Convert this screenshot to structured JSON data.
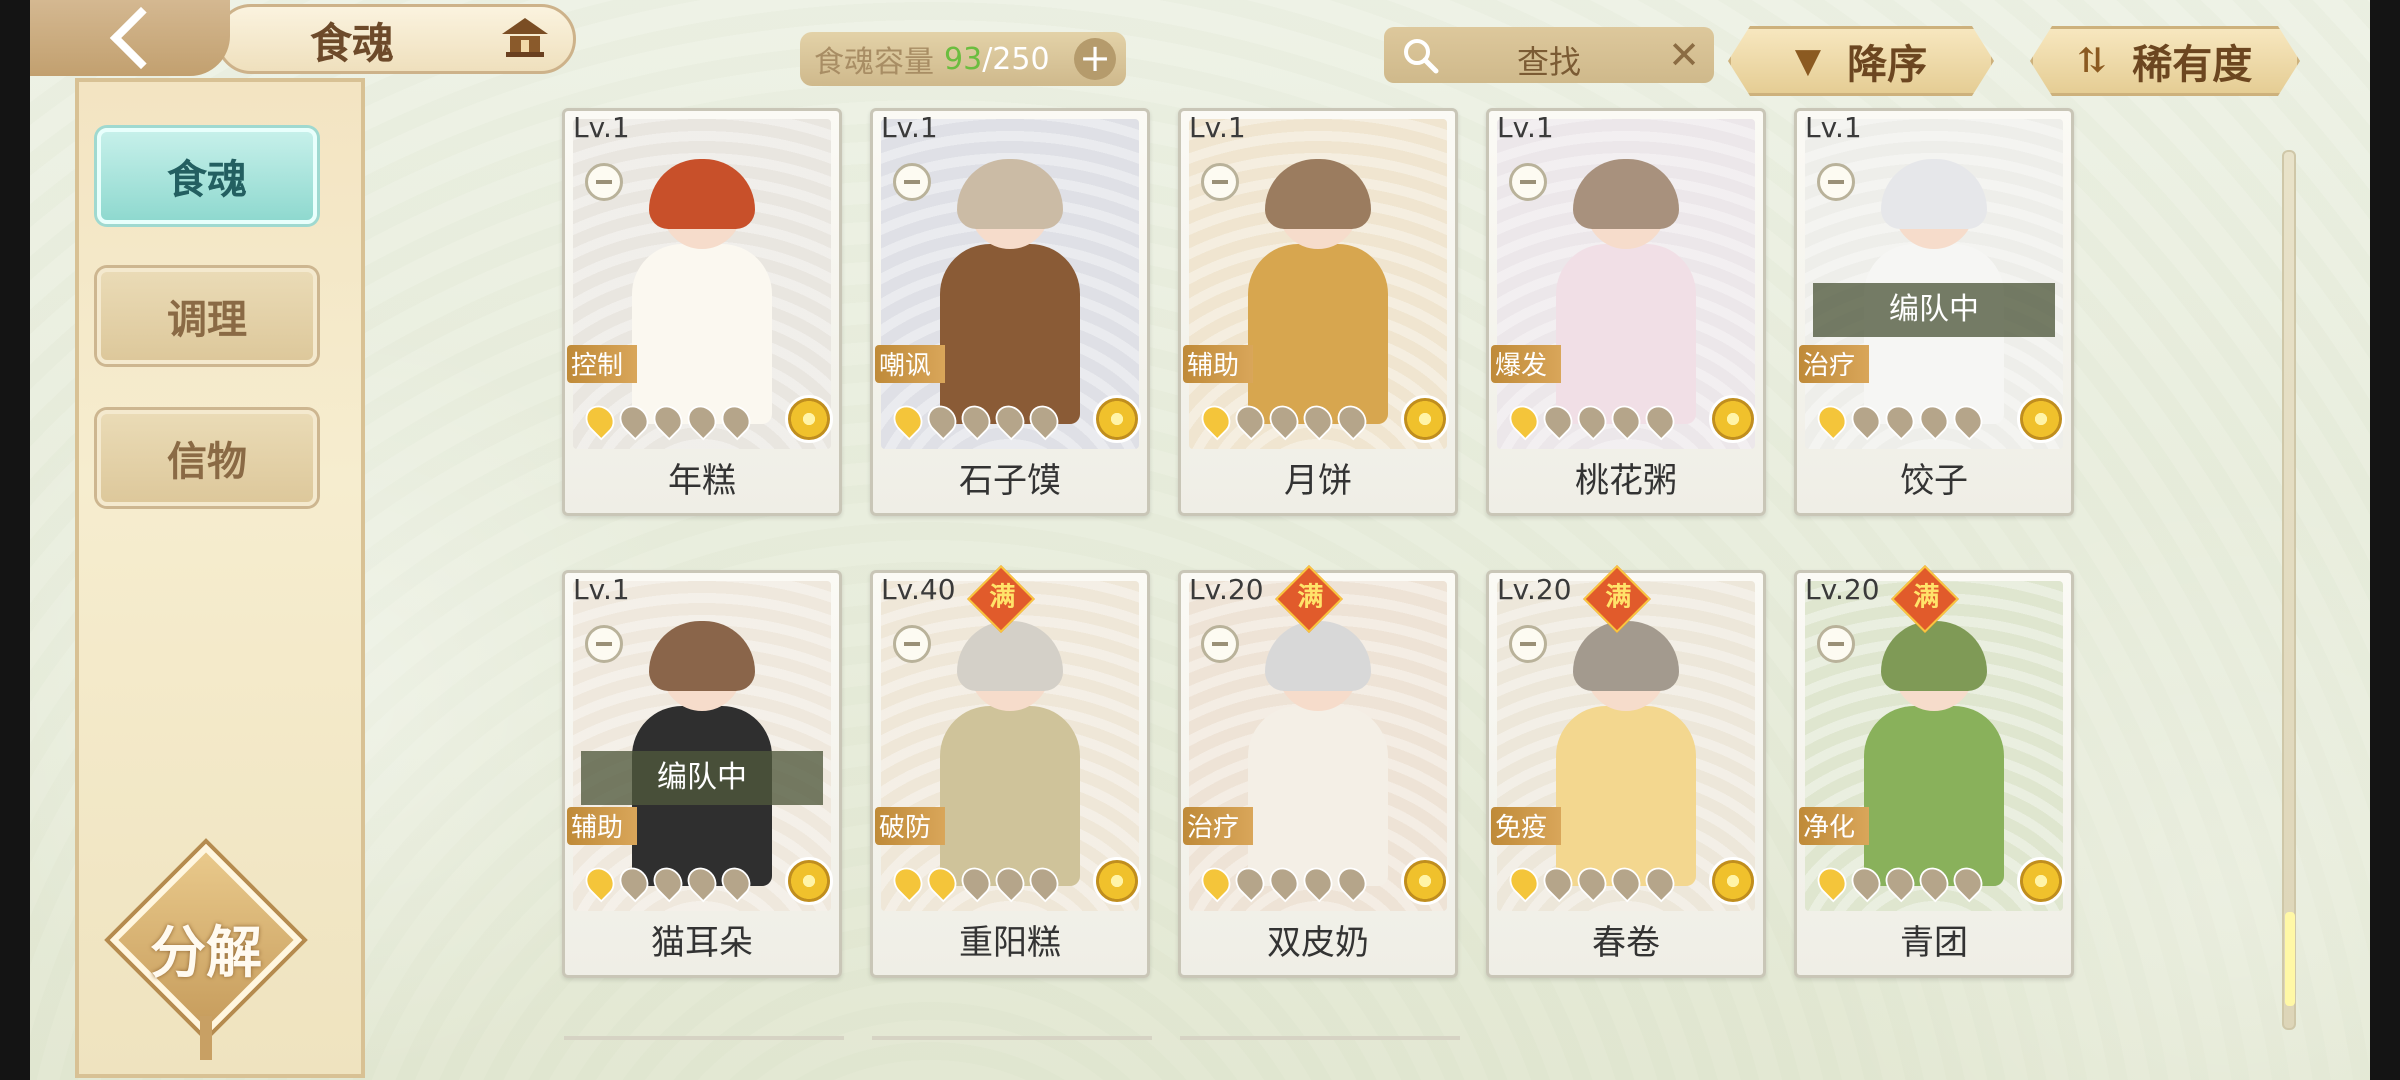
{
  "header": {
    "title": "食魂",
    "capacity_label": "食魂容量",
    "capacity_current": "93",
    "capacity_sep": "/",
    "capacity_max": "250",
    "search_placeholder": "查找",
    "sort_order_label": "降序",
    "sort_field_label": "稀有度"
  },
  "sidebar": {
    "items": [
      {
        "label": "食魂",
        "active": true
      },
      {
        "label": "调理",
        "active": false
      },
      {
        "label": "信物",
        "active": false
      }
    ],
    "decompose_label": "分解"
  },
  "cards": [
    {
      "level": "Lv.1",
      "role": "控制",
      "name": "年糕",
      "stars": 1,
      "maxed": false,
      "in_team": false,
      "hair": "#c8502a",
      "outfit": "#fbf8f0",
      "bg": "#e9e6e0"
    },
    {
      "level": "Lv.1",
      "role": "嘲讽",
      "name": "石子馍",
      "stars": 1,
      "maxed": false,
      "in_team": false,
      "hair": "#cbbba5",
      "outfit": "#8a5b36",
      "bg": "#dfe0e6"
    },
    {
      "level": "Lv.1",
      "role": "辅助",
      "name": "月饼",
      "stars": 1,
      "maxed": false,
      "in_team": false,
      "hair": "#9b7c5f",
      "outfit": "#d7a64f",
      "bg": "#f0e5d0"
    },
    {
      "level": "Lv.1",
      "role": "爆发",
      "name": "桃花粥",
      "stars": 1,
      "maxed": false,
      "in_team": false,
      "hair": "#a8917d",
      "outfit": "#f1dfe6",
      "bg": "#ece7ea"
    },
    {
      "level": "Lv.1",
      "role": "治疗",
      "name": "饺子",
      "stars": 1,
      "maxed": false,
      "in_team": true,
      "team_label": "编队中",
      "hair": "#e6e7ea",
      "outfit": "#f6f6f4",
      "bg": "#eeeeea"
    },
    {
      "level": "Lv.1",
      "role": "辅助",
      "name": "猫耳朵",
      "stars": 1,
      "maxed": false,
      "in_team": true,
      "team_label": "编队中",
      "hair": "#8a654a",
      "outfit": "#2f2f2f",
      "bg": "#efe8dd"
    },
    {
      "level": "Lv.40",
      "role": "破防",
      "name": "重阳糕",
      "stars": 2,
      "maxed": true,
      "max_label": "满",
      "in_team": false,
      "hair": "#d4d0c8",
      "outfit": "#cfc39a",
      "bg": "#efe7d8"
    },
    {
      "level": "Lv.20",
      "role": "治疗",
      "name": "双皮奶",
      "stars": 1,
      "maxed": true,
      "max_label": "满",
      "in_team": false,
      "hair": "#d8d8d8",
      "outfit": "#f4efe6",
      "bg": "#eee3d6"
    },
    {
      "level": "Lv.20",
      "role": "免疫",
      "name": "春卷",
      "stars": 1,
      "maxed": true,
      "max_label": "满",
      "in_team": false,
      "hair": "#a39a8e",
      "outfit": "#f3d78f",
      "bg": "#ede7da"
    },
    {
      "level": "Lv.20",
      "role": "净化",
      "name": "青团",
      "stars": 1,
      "maxed": true,
      "max_label": "满",
      "in_team": false,
      "hair": "#7f9a56",
      "outfit": "#89b15b",
      "bg": "#dfe6cf"
    }
  ]
}
